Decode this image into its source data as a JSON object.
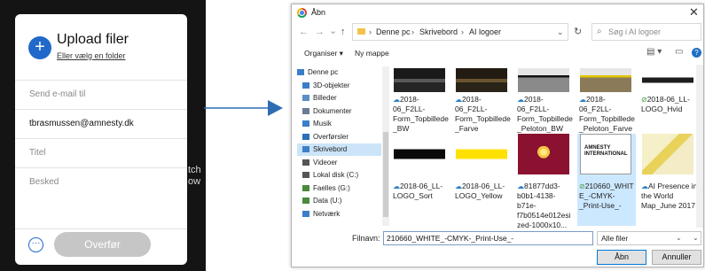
{
  "upload_panel": {
    "title": "Upload filer",
    "subtitle": "Eller vælg en folder",
    "plus": "+",
    "fields": {
      "send_to": "Send e-mail til",
      "email": "tbrasmussen@amnesty.dk",
      "title": "Titel",
      "message": "Besked"
    },
    "more": "···",
    "send_button": "Overfør",
    "background_text": "tch\now"
  },
  "dialog": {
    "title": "Åbn",
    "close": "✕",
    "nav": {
      "back": "←",
      "forward": "→",
      "down": "⌄",
      "up": "↑"
    },
    "breadcrumb": [
      "Denne pc",
      "Skrivebord",
      "AI logoer"
    ],
    "search_placeholder": "Søg i AI logoer",
    "toolbar": {
      "organize": "Organiser ▾",
      "new_folder": "Ny mappe"
    },
    "nav_pane": [
      {
        "label": "Denne pc",
        "icon": "computer-icon",
        "color": "#3a7fc8",
        "selected": false
      },
      {
        "label": "3D-objekter",
        "icon": "cube-icon",
        "color": "#3a7fc8",
        "selected": false
      },
      {
        "label": "Billeder",
        "icon": "pictures-icon",
        "color": "#5a8fc8",
        "selected": false
      },
      {
        "label": "Dokumenter",
        "icon": "documents-icon",
        "color": "#6b7c93",
        "selected": false
      },
      {
        "label": "Musik",
        "icon": "music-icon",
        "color": "#3a7fc8",
        "selected": false
      },
      {
        "label": "Overførsler",
        "icon": "download-icon",
        "color": "#2a6fb8",
        "selected": false
      },
      {
        "label": "Skrivebord",
        "icon": "desktop-icon",
        "color": "#3a7fc8",
        "selected": true
      },
      {
        "label": "Videoer",
        "icon": "videos-icon",
        "color": "#555555",
        "selected": false
      },
      {
        "label": "Lokal disk (C:)",
        "icon": "drive-icon",
        "color": "#555555",
        "selected": false
      },
      {
        "label": "Faelles (G:)",
        "icon": "network-drive-icon",
        "color": "#4a8a3a",
        "selected": false
      },
      {
        "label": "Data (U:)",
        "icon": "network-drive-icon",
        "color": "#4a8a3a",
        "selected": false
      },
      {
        "label": "Netværk",
        "icon": "network-icon",
        "color": "#3a7fc8",
        "selected": false
      }
    ],
    "files": [
      {
        "name": "2018-06_F2LL-Form_Topbillede_BW",
        "sync": "cloud",
        "thumb": "photo-bw"
      },
      {
        "name": "2018-06_F2LL-Form_Topbillede_Farve",
        "sync": "cloud",
        "thumb": "photo-color"
      },
      {
        "name": "2018-06_F2LL-Form_Topbillede_Peloton_BW",
        "sync": "cloud",
        "thumb": "photo-peloton-bw"
      },
      {
        "name": "2018-06_F2LL-Form_Topbillede_Peloton_Farve",
        "sync": "cloud",
        "thumb": "photo-peloton-color"
      },
      {
        "name": "2018-06_LL-LOGO_Hvid",
        "sync": "check",
        "thumb": "logo-white"
      },
      {
        "name": "2018-06_LL-LOGO_Sort",
        "sync": "cloud",
        "thumb": "logo-black"
      },
      {
        "name": "2018-06_LL-LOGO_Yellow",
        "sync": "cloud",
        "thumb": "logo-yellow"
      },
      {
        "name": "81877dd3-b0b1-4138-b71e-f7b0514e012esized-1000x10...",
        "sync": "cloud",
        "thumb": "candle"
      },
      {
        "name": "210660_WHITE_-CMYK-_Print-Use_-",
        "sync": "check",
        "thumb": "amnesty-logo"
      },
      {
        "name": "AI Presence in the World Map_June 2017",
        "sync": "cloud",
        "thumb": "world-map"
      }
    ],
    "amnesty_logo_text": "AMNESTY\nINTERNATIONAL",
    "filename_label": "Filnavn:",
    "filename_value": "210660_WHITE_-CMYK-_Print-Use_-",
    "filetype_value": "Alle filer",
    "open_button": "Åbn",
    "cancel_button": "Annuller",
    "colors": {
      "accent": "#0078d7",
      "selection": "#cce8ff",
      "upload_blue": "#2068c9",
      "arrow_blue": "#2e6db4",
      "lifeline_yellow": "#ffe100"
    }
  }
}
